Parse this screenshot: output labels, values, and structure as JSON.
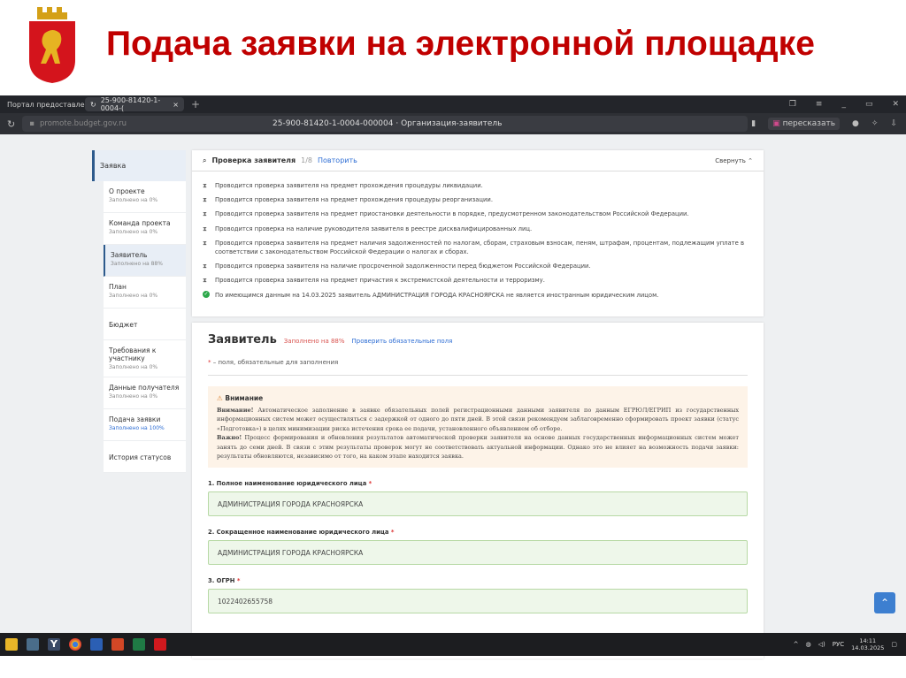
{
  "slide": {
    "title": "Подача заявки на электронной площадке"
  },
  "browser": {
    "tab0": "Портал предоставлени",
    "tab1": "25-900-81420-1-0004-(",
    "url": "promote.budget.gov.ru",
    "page_title": "25-900-81420-1-0004-000004 · Организация-заявитель",
    "retell": "пересказать"
  },
  "sidebar": {
    "head": "Заявка",
    "items": [
      {
        "label": "О проекте",
        "status": "Заполнено на 0%"
      },
      {
        "label": "Команда проекта",
        "status": "Заполнено на 0%"
      },
      {
        "label": "Заявитель",
        "status": "Заполнено на 88%"
      },
      {
        "label": "План",
        "status": "Заполнено на 0%"
      },
      {
        "label": "Бюджет"
      },
      {
        "label": "Требования к участнику",
        "status": "Заполнено на 0%"
      },
      {
        "label": "Данные получателя",
        "status": "Заполнено на 0%"
      },
      {
        "label": "Подача заявки",
        "status": "Заполнено на 100%"
      },
      {
        "label": "История статусов"
      }
    ]
  },
  "check": {
    "title": "Проверка заявителя",
    "count": "1/8",
    "retry": "Повторить",
    "collapse": "Свернуть",
    "items": [
      "Проводится проверка заявителя на предмет прохождения процедуры ликвидации.",
      "Проводится проверка заявителя на предмет прохождения процедуры реорганизации.",
      "Проводится проверка заявителя на предмет приостановки деятельности в порядке, предусмотренном законодательством Российской Федерации.",
      "Проводится проверка на наличие руководителя заявителя в реестре дисквалифицированных лиц.",
      "Проводится проверка заявителя на предмет наличия задолженностей по налогам, сборам, страховым взносам, пеням, штрафам, процентам, подлежащим уплате в соответствии с законодательством Российской Федерации о налогах и сборах.",
      "Проводится проверка заявителя на наличие просроченной задолженности перед бюджетом Российской Федерации.",
      "Проводится проверка заявителя на предмет причастия к экстремистской деятельности и терроризму."
    ],
    "ok": "По имеющимся данным на 14.03.2025 заявитель АДМИНИСТРАЦИЯ ГОРОДА КРАСНОЯРСКА не является иностранным юридическим лицом."
  },
  "form": {
    "title": "Заявитель",
    "filled": "Заполнено на 88%",
    "check_link": "Проверить обязательные поля",
    "required_note": "– поля, обязательные для заполнения",
    "warn_title": "Внимание",
    "warn1_b": "Внимание!",
    "warn1": " Автоматическое заполнение в заявке обязательных полей регистрационными данными заявителя по данным ЕГРЮЛ/ЕГРИП из государственных информационных систем может осуществляться с задержкой от одного до пяти дней. В этой связи рекомендуем заблаговременно сформировать проект заявки (статус «Подготовка») в целях минимизации риска истечения срока ее подачи, установленного объявлением об отборе.",
    "warn2_b": "Важно!",
    "warn2": " Процесс формирования и обновления результатов автоматической проверки заявителя на основе данных государственных информационных систем может занять до семи дней. В связи с этим результаты проверок могут не соответствовать актуальной информации. Однако это не влияет на возможность подачи заявки: результаты обновляются, независимо от того, на каком этапе находится заявка.",
    "fields": [
      {
        "label": "1. Полное наименование юридического лица",
        "value": "АДМИНИСТРАЦИЯ ГОРОДА КРАСНОЯРСКА"
      },
      {
        "label": "2. Сокращенное наименование юридического лица",
        "value": "АДМИНИСТРАЦИЯ ГОРОДА КРАСНОЯРСКА"
      },
      {
        "label": "3. ОГРН",
        "value": "1022402655758"
      }
    ]
  },
  "taskbar": {
    "lang": "РУС",
    "time": "14:11",
    "date": "14.03.2025"
  }
}
